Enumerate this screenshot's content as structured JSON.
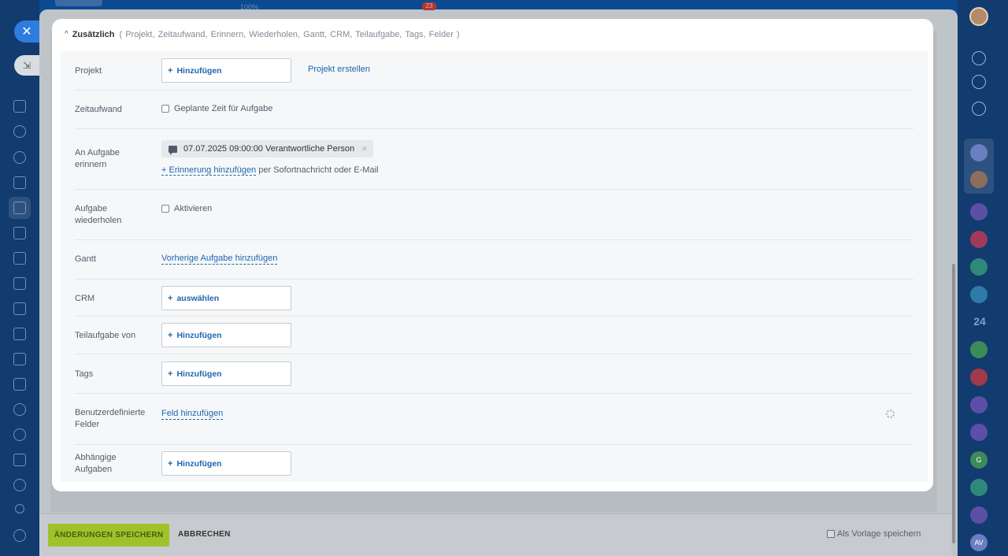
{
  "background": {
    "top_zoom": "100%",
    "top_badge": "23",
    "right_sidebar_counter": "24",
    "right_sidebar_initials": [
      "G",
      "AV"
    ]
  },
  "section": {
    "title": "Zusätzlich",
    "items_list": "( Projekt,  Zeitaufwand,  Erinnern,  Wiederholen,  Gantt,  CRM,  Teilaufgabe,  Tags,  Felder )"
  },
  "rows": {
    "project": {
      "label": "Projekt",
      "add_label": "Hinzufügen",
      "create_link": "Projekt erstellen"
    },
    "time": {
      "label": "Zeitaufwand",
      "checkbox_label": "Geplante Zeit für Aufgabe"
    },
    "reminder": {
      "label": "An Aufgabe erinnern",
      "chip_text": "07.07.2025 09:00:00 Verantwortliche Person",
      "add_link": "+ Erinnerung hinzufügen",
      "add_suffix": " per Sofortnachricht oder E-Mail"
    },
    "repeat": {
      "label": "Aufgabe wiederholen",
      "checkbox_label": "Aktivieren"
    },
    "gantt": {
      "label": "Gantt",
      "link": "Vorherige Aufgabe hinzufügen"
    },
    "crm": {
      "label": "CRM",
      "add_label": "auswählen"
    },
    "subtask": {
      "label": "Teilaufgabe von",
      "add_label": "Hinzufügen"
    },
    "tags": {
      "label": "Tags",
      "add_label": "Hinzufügen"
    },
    "custom_fields": {
      "label": "Benutzerdefinierte Felder",
      "link": "Feld hinzufügen"
    },
    "dependent": {
      "label": "Abhängige Aufgaben",
      "add_label": "Hinzufügen"
    }
  },
  "footer": {
    "save_label": "ÄNDERUNGEN SPEICHERN",
    "cancel_label": "ABBRECHEN",
    "template_label": "Als Vorlage speichern"
  },
  "colors": {
    "accent_blue": "#2067b0",
    "save_green": "#9fc22a",
    "card_bg": "#ffffff",
    "form_bg": "#f5f7f8"
  }
}
